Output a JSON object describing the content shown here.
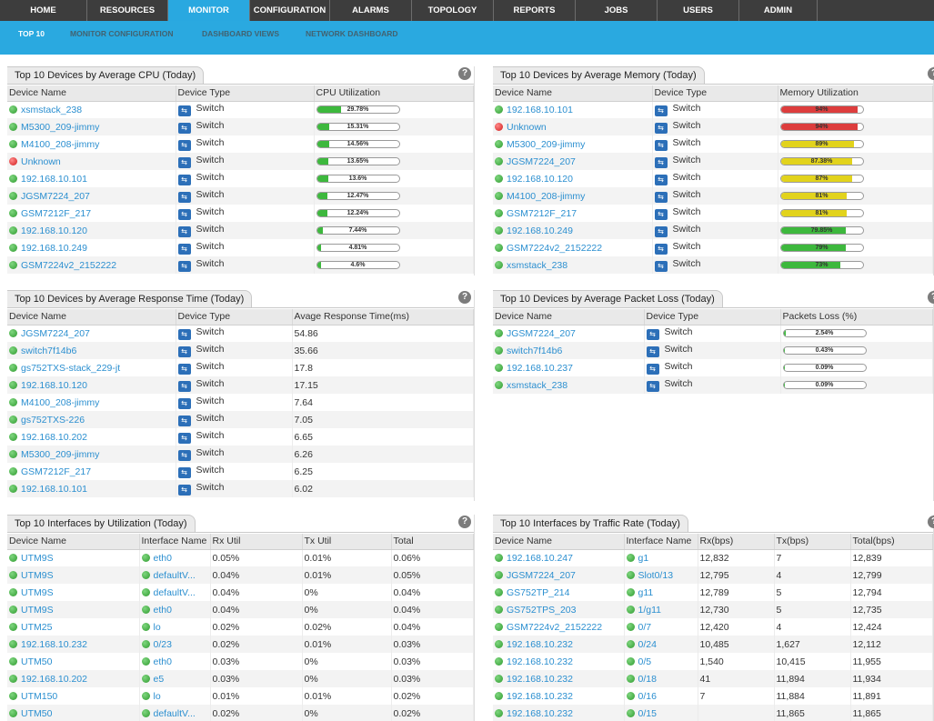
{
  "nav": {
    "tabs": [
      "HOME",
      "RESOURCES",
      "MONITOR",
      "CONFIGURATION",
      "ALARMS",
      "TOPOLOGY",
      "REPORTS",
      "JOBS",
      "USERS",
      "ADMIN"
    ],
    "active": "MONITOR",
    "sub_tabs": [
      "TOP 10",
      "MONITOR CONFIGURATION",
      "DASHBOARD VIEWS",
      "NETWORK DASHBOARD"
    ],
    "active_sub": "TOP 10"
  },
  "help_label": "?",
  "colors": {
    "green": "#3db83d",
    "yellow": "#e2d31c",
    "red": "#dd3d3d",
    "accent": "#2aa9e0"
  },
  "cpu": {
    "title": "Top 10 Devices by Average CPU (Today)",
    "headers": [
      "Device Name",
      "Device Type",
      "CPU Utilization"
    ],
    "rows": [
      {
        "name": "xsmstack_238",
        "status": "up",
        "type": "Switch",
        "value": 29.78,
        "label": "29.78%"
      },
      {
        "name": "M5300_209-jimmy",
        "status": "up",
        "type": "Switch",
        "value": 15.31,
        "label": "15.31%"
      },
      {
        "name": "M4100_208-jimmy",
        "status": "up",
        "type": "Switch",
        "value": 14.56,
        "label": "14.56%"
      },
      {
        "name": "Unknown",
        "status": "down",
        "type": "Switch",
        "value": 13.65,
        "label": "13.65%"
      },
      {
        "name": "192.168.10.101",
        "status": "up",
        "type": "Switch",
        "value": 13.6,
        "label": "13.6%"
      },
      {
        "name": "JGSM7224_207",
        "status": "up",
        "type": "Switch",
        "value": 12.47,
        "label": "12.47%"
      },
      {
        "name": "GSM7212F_217",
        "status": "up",
        "type": "Switch",
        "value": 12.24,
        "label": "12.24%"
      },
      {
        "name": "192.168.10.120",
        "status": "up",
        "type": "Switch",
        "value": 7.44,
        "label": "7.44%"
      },
      {
        "name": "192.168.10.249",
        "status": "up",
        "type": "Switch",
        "value": 4.81,
        "label": "4.81%"
      },
      {
        "name": "GSM7224v2_2152222",
        "status": "up",
        "type": "Switch",
        "value": 4.6,
        "label": "4.6%"
      }
    ]
  },
  "memory": {
    "title": "Top 10 Devices by Average Memory (Today)",
    "headers": [
      "Device Name",
      "Device Type",
      "Memory Utilization"
    ],
    "rows": [
      {
        "name": "192.168.10.101",
        "status": "up",
        "type": "Switch",
        "value": 94,
        "label": "94%",
        "color": "red"
      },
      {
        "name": "Unknown",
        "status": "down",
        "type": "Switch",
        "value": 94,
        "label": "94%",
        "color": "red"
      },
      {
        "name": "M5300_209-jimmy",
        "status": "up",
        "type": "Switch",
        "value": 89,
        "label": "89%",
        "color": "yellow"
      },
      {
        "name": "JGSM7224_207",
        "status": "up",
        "type": "Switch",
        "value": 87.38,
        "label": "87.38%",
        "color": "yellow"
      },
      {
        "name": "192.168.10.120",
        "status": "up",
        "type": "Switch",
        "value": 87,
        "label": "87%",
        "color": "yellow"
      },
      {
        "name": "M4100_208-jimmy",
        "status": "up",
        "type": "Switch",
        "value": 81,
        "label": "81%",
        "color": "yellow"
      },
      {
        "name": "GSM7212F_217",
        "status": "up",
        "type": "Switch",
        "value": 81,
        "label": "81%",
        "color": "yellow"
      },
      {
        "name": "192.168.10.249",
        "status": "up",
        "type": "Switch",
        "value": 79.85,
        "label": "79.85%",
        "color": "green"
      },
      {
        "name": "GSM7224v2_2152222",
        "status": "up",
        "type": "Switch",
        "value": 79,
        "label": "79%",
        "color": "green"
      },
      {
        "name": "xsmstack_238",
        "status": "up",
        "type": "Switch",
        "value": 73,
        "label": "73%",
        "color": "green"
      }
    ]
  },
  "response": {
    "title": "Top 10 Devices by Average Response Time (Today)",
    "headers": [
      "Device Name",
      "Device Type",
      "Avage Response Time(ms)"
    ],
    "rows": [
      {
        "name": "JGSM7224_207",
        "status": "up",
        "type": "Switch",
        "value": "54.86"
      },
      {
        "name": "switch7f14b6",
        "status": "up",
        "type": "Switch",
        "value": "35.66"
      },
      {
        "name": "gs752TXS-stack_229-jt",
        "status": "up",
        "type": "Switch",
        "value": "17.8"
      },
      {
        "name": "192.168.10.120",
        "status": "up",
        "type": "Switch",
        "value": "17.15"
      },
      {
        "name": "M4100_208-jimmy",
        "status": "up",
        "type": "Switch",
        "value": "7.64"
      },
      {
        "name": "gs752TXS-226",
        "status": "up",
        "type": "Switch",
        "value": "7.05"
      },
      {
        "name": "192.168.10.202",
        "status": "up",
        "type": "Switch",
        "value": "6.65"
      },
      {
        "name": "M5300_209-jimmy",
        "status": "up",
        "type": "Switch",
        "value": "6.26"
      },
      {
        "name": "GSM7212F_217",
        "status": "up",
        "type": "Switch",
        "value": "6.25"
      },
      {
        "name": "192.168.10.101",
        "status": "up",
        "type": "Switch",
        "value": "6.02"
      }
    ]
  },
  "packet": {
    "title": "Top 10 Devices by Average Packet Loss (Today)",
    "headers": [
      "Device Name",
      "Device Type",
      "Packets Loss (%)"
    ],
    "rows": [
      {
        "name": "JGSM7224_207",
        "status": "up",
        "type": "Switch",
        "value": 2.54,
        "label": "2.54%"
      },
      {
        "name": "switch7f14b6",
        "status": "up",
        "type": "Switch",
        "value": 0.43,
        "label": "0.43%"
      },
      {
        "name": "192.168.10.237",
        "status": "up",
        "type": "Switch",
        "value": 0.09,
        "label": "0.09%"
      },
      {
        "name": "xsmstack_238",
        "status": "up",
        "type": "Switch",
        "value": 0.09,
        "label": "0.09%"
      }
    ]
  },
  "ifutil": {
    "title": "Top 10 Interfaces by Utilization (Today)",
    "headers": [
      "Device Name",
      "Interface Name",
      "Rx Util",
      "Tx Util",
      "Total"
    ],
    "rows": [
      [
        "UTM9S",
        "eth0",
        "0.05%",
        "0.01%",
        "0.06%"
      ],
      [
        "UTM9S",
        "defaultV...",
        "0.04%",
        "0.01%",
        "0.05%"
      ],
      [
        "UTM9S",
        "defaultV...",
        "0.04%",
        "0%",
        "0.04%"
      ],
      [
        "UTM9S",
        "eth0",
        "0.04%",
        "0%",
        "0.04%"
      ],
      [
        "UTM25",
        "lo",
        "0.02%",
        "0.02%",
        "0.04%"
      ],
      [
        "192.168.10.232",
        "0/23",
        "0.02%",
        "0.01%",
        "0.03%"
      ],
      [
        "UTM50",
        "eth0",
        "0.03%",
        "0%",
        "0.03%"
      ],
      [
        "192.168.10.202",
        "e5",
        "0.03%",
        "0%",
        "0.03%"
      ],
      [
        "UTM150",
        "lo",
        "0.01%",
        "0.01%",
        "0.02%"
      ],
      [
        "UTM50",
        "defaultV...",
        "0.02%",
        "0%",
        "0.02%"
      ]
    ]
  },
  "traffic": {
    "title": "Top 10 Interfaces by Traffic Rate (Today)",
    "headers": [
      "Device Name",
      "Interface Name",
      "Rx(bps)",
      "Tx(bps)",
      "Total(bps)"
    ],
    "rows": [
      [
        "192.168.10.247",
        "g1",
        "12,832",
        "7",
        "12,839"
      ],
      [
        "JGSM7224_207",
        "Slot0/13",
        "12,795",
        "4",
        "12,799"
      ],
      [
        "GS752TP_214",
        "g11",
        "12,789",
        "5",
        "12,794"
      ],
      [
        "GS752TPS_203",
        "1/g11",
        "12,730",
        "5",
        "12,735"
      ],
      [
        "GSM7224v2_2152222",
        "0/7",
        "12,420",
        "4",
        "12,424"
      ],
      [
        "192.168.10.232",
        "0/24",
        "10,485",
        "1,627",
        "12,112"
      ],
      [
        "192.168.10.232",
        "0/5",
        "1,540",
        "10,415",
        "11,955"
      ],
      [
        "192.168.10.232",
        "0/18",
        "41",
        "11,894",
        "11,934"
      ],
      [
        "192.168.10.232",
        "0/16",
        "7",
        "11,884",
        "11,891"
      ],
      [
        "192.168.10.232",
        "0/15",
        "",
        "11,865",
        "11,865"
      ]
    ]
  }
}
